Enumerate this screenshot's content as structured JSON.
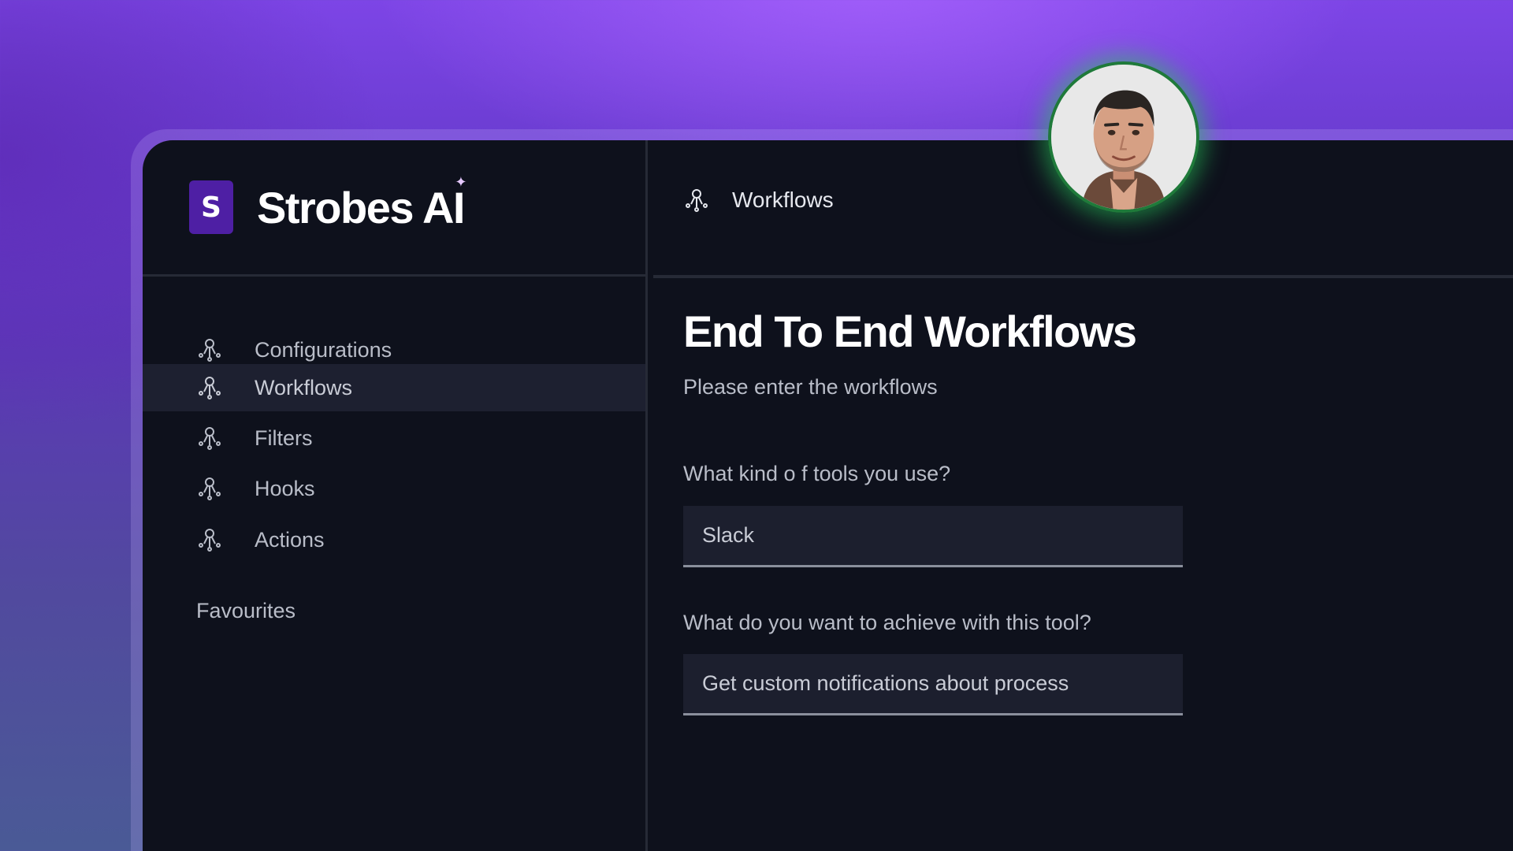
{
  "brand": {
    "logo_letter": "S",
    "name": "Strobes AI",
    "sparkle": "✦"
  },
  "sidebar": {
    "items": [
      {
        "label": "Configurations",
        "icon": "workflow-icon",
        "active": false
      },
      {
        "label": "Workflows",
        "icon": "workflow-icon",
        "active": true
      },
      {
        "label": "Filters",
        "icon": "workflow-icon",
        "active": false
      },
      {
        "label": "Hooks",
        "icon": "workflow-icon",
        "active": false
      },
      {
        "label": "Actions",
        "icon": "workflow-icon",
        "active": false
      }
    ],
    "section_label": "Favourites"
  },
  "header": {
    "title": "Workflows",
    "icon": "workflow-icon"
  },
  "main": {
    "title": "End To End Workflows",
    "subtitle": "Please enter the workflows",
    "fields": [
      {
        "label": "What kind o f tools you use?",
        "value": "Slack"
      },
      {
        "label": "What do you want to achieve with this tool?",
        "value": "Get custom notifications about process"
      }
    ]
  },
  "user": {
    "avatar": "user-avatar",
    "status_color": "#2bd064"
  },
  "colors": {
    "accent": "#4e1fa4",
    "background": "#0e111c",
    "active_item": "#1d2030",
    "input_bg": "#1c1f2e"
  }
}
